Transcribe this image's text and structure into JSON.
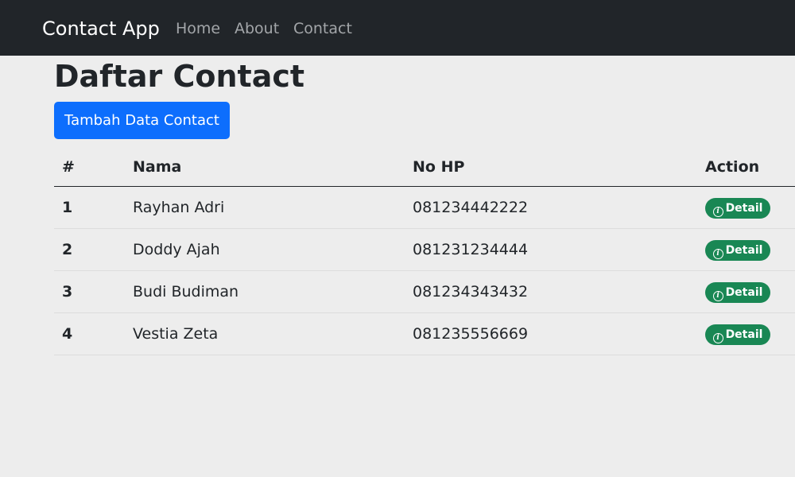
{
  "navbar": {
    "brand": "Contact App",
    "links": [
      "Home",
      "About",
      "Contact"
    ]
  },
  "page": {
    "title": "Daftar Contact",
    "add_button_label": "Tambah Data Contact"
  },
  "table": {
    "headers": [
      "#",
      "Nama",
      "No HP",
      "Action"
    ],
    "rows": [
      {
        "num": "1",
        "name": "Rayhan Adri",
        "phone": "081234442222",
        "action": "Detail"
      },
      {
        "num": "2",
        "name": "Doddy Ajah",
        "phone": "081231234444",
        "action": "Detail"
      },
      {
        "num": "3",
        "name": "Budi Budiman",
        "phone": "081234343432",
        "action": "Detail"
      },
      {
        "num": "4",
        "name": "Vestia Zeta",
        "phone": "081235556669",
        "action": "Detail"
      }
    ]
  },
  "icons": {
    "detail": "info-circle-icon"
  },
  "colors": {
    "navbar_bg": "#212529",
    "primary": "#0d6efd",
    "success": "#198754",
    "page_bg": "#ededed"
  }
}
